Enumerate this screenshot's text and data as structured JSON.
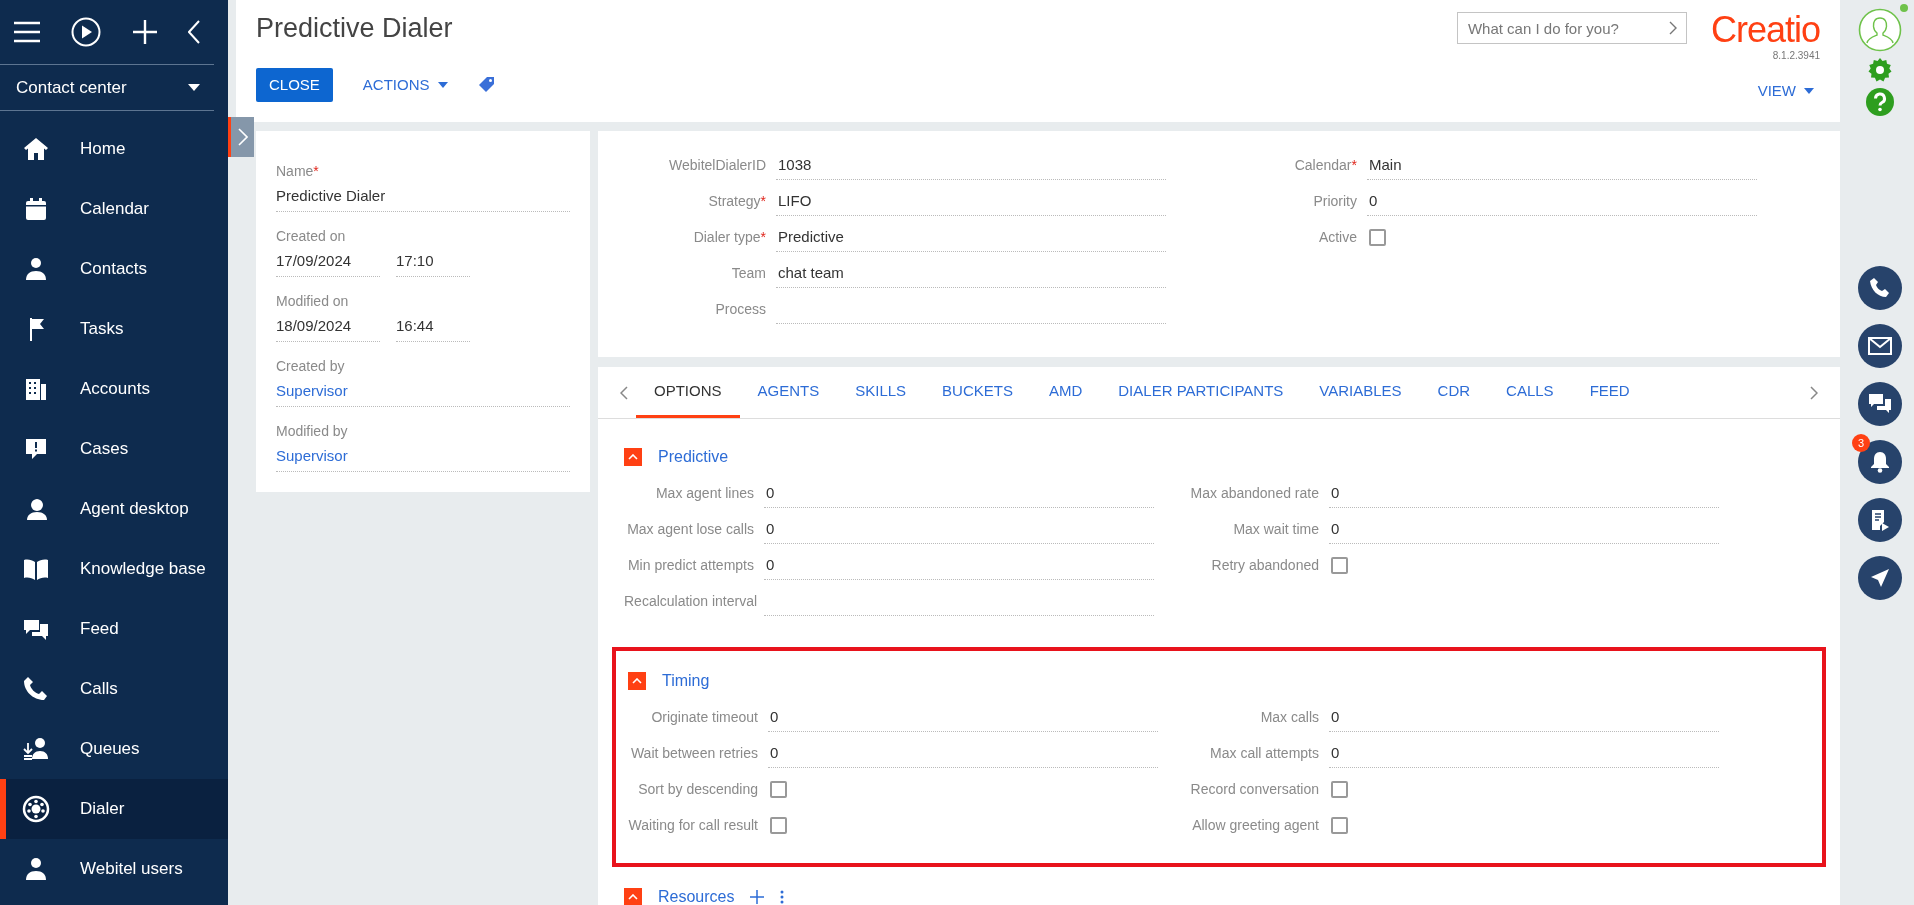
{
  "sidebar": {
    "workplace": "Contact center",
    "items": [
      {
        "label": "Home",
        "selected": false
      },
      {
        "label": "Calendar",
        "selected": false
      },
      {
        "label": "Contacts",
        "selected": false
      },
      {
        "label": "Tasks",
        "selected": false
      },
      {
        "label": "Accounts",
        "selected": false
      },
      {
        "label": "Cases",
        "selected": false
      },
      {
        "label": "Agent desktop",
        "selected": false
      },
      {
        "label": "Knowledge base",
        "selected": false
      },
      {
        "label": "Feed",
        "selected": false
      },
      {
        "label": "Calls",
        "selected": false
      },
      {
        "label": "Queues",
        "selected": false
      },
      {
        "label": "Dialer",
        "selected": true
      },
      {
        "label": "Webitel users",
        "selected": false
      }
    ]
  },
  "header": {
    "title": "Predictive Dialer",
    "close": "CLOSE",
    "actions": "ACTIONS",
    "search": {
      "placeholder": "What can I do for you?"
    },
    "logo": "Creatio",
    "version": "8.1.2.3941",
    "view": "VIEW"
  },
  "summary": {
    "fields": [
      {
        "kind": "text",
        "label": "Name",
        "mark": "*",
        "value": "Predictive Dialer"
      },
      {
        "kind": "datetime",
        "label": "Created on",
        "date": "17/09/2024",
        "time": "17:10"
      },
      {
        "kind": "datetime",
        "label": "Modified on",
        "date": "18/09/2024",
        "time": "16:44"
      },
      {
        "kind": "link",
        "label": "Created by",
        "value": "Supervisor"
      },
      {
        "kind": "link",
        "label": "Modified by",
        "value": "Supervisor"
      }
    ]
  },
  "details": {
    "left": [
      {
        "kind": "text",
        "label": "WebitelDialerID",
        "value": "1038"
      },
      {
        "kind": "text",
        "label": "Strategy",
        "mark": "*",
        "value": "LIFO"
      },
      {
        "kind": "text",
        "label": "Dialer type",
        "mark": "*",
        "value": "Predictive"
      },
      {
        "kind": "text",
        "label": "Team",
        "value": "chat  team"
      },
      {
        "kind": "text",
        "label": "Process"
      }
    ],
    "right": [
      {
        "kind": "text",
        "label": "Calendar",
        "mark": "*",
        "value": "Main"
      },
      {
        "kind": "text",
        "label": "Priority",
        "value": "0"
      },
      {
        "kind": "checkbox",
        "label": "Active",
        "checked": false
      }
    ]
  },
  "tabs": [
    {
      "label": "OPTIONS",
      "selected": true
    },
    {
      "label": "AGENTS",
      "selected": false
    },
    {
      "label": "SKILLS",
      "selected": false
    },
    {
      "label": "BUCKETS",
      "selected": false
    },
    {
      "label": "AMD",
      "selected": false
    },
    {
      "label": "DIALER PARTICIPANTS",
      "selected": false
    },
    {
      "label": "VARIABLES",
      "selected": false
    },
    {
      "label": "CDR",
      "selected": false
    },
    {
      "label": "CALLS",
      "selected": false
    },
    {
      "label": "FEED",
      "selected": false
    }
  ],
  "sections": [
    {
      "title": "Predictive",
      "expanded": true,
      "left": [
        {
          "kind": "text",
          "label": "Max agent lines",
          "value": "0"
        },
        {
          "kind": "text",
          "label": "Max agent lose calls",
          "value": "0"
        },
        {
          "kind": "text",
          "label": "Min predict attempts",
          "value": "0"
        },
        {
          "kind": "text",
          "label": "Recalculation interval"
        }
      ],
      "right": [
        {
          "kind": "text",
          "label": "Max abandoned rate",
          "value": "0"
        },
        {
          "kind": "text",
          "label": "Max wait time",
          "value": "0"
        },
        {
          "kind": "checkbox",
          "label": "Retry abandoned",
          "checked": false
        }
      ]
    },
    {
      "title": "Timing",
      "expanded": true,
      "highlighted": true,
      "left": [
        {
          "kind": "text",
          "label": "Originate timeout",
          "value": "0"
        },
        {
          "kind": "text",
          "label": "Wait between retries",
          "value": "0"
        },
        {
          "kind": "checkbox",
          "label": "Sort by descending",
          "checked": false
        },
        {
          "kind": "checkbox",
          "label": "Waiting for call result",
          "checked": false
        }
      ],
      "right": [
        {
          "kind": "text",
          "label": "Max calls",
          "value": "0"
        },
        {
          "kind": "text",
          "label": "Max call attempts",
          "value": "0"
        },
        {
          "kind": "checkbox",
          "label": "Record conversation",
          "checked": false
        },
        {
          "kind": "checkbox",
          "label": "Allow greeting agent",
          "checked": false
        }
      ]
    },
    {
      "title": "Resources",
      "expanded": true,
      "tools": true
    }
  ],
  "rightbar": {
    "online": true,
    "notifications": "3"
  }
}
